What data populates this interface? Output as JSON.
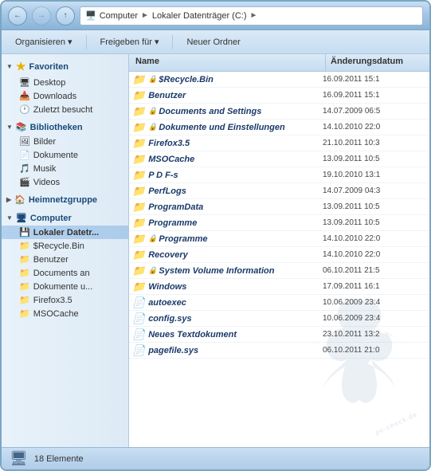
{
  "window": {
    "title": "Lokaler Datenträger (C:)"
  },
  "breadcrumb": {
    "parts": [
      "Computer",
      "Lokaler Datenträger (C:)"
    ]
  },
  "toolbar": {
    "buttons": [
      {
        "label": "Organisieren",
        "has_arrow": true
      },
      {
        "label": "Freigeben für",
        "has_arrow": true
      },
      {
        "label": "Neuer Ordner",
        "has_arrow": false
      }
    ]
  },
  "sidebar": {
    "sections": [
      {
        "header": "Favoriten",
        "expanded": true,
        "items": [
          {
            "label": "Desktop",
            "icon": "desktop"
          },
          {
            "label": "Downloads",
            "icon": "download"
          },
          {
            "label": "Zuletzt besucht",
            "icon": "recent"
          }
        ]
      },
      {
        "header": "Bibliotheken",
        "expanded": true,
        "items": [
          {
            "label": "Bilder",
            "icon": "lib"
          },
          {
            "label": "Dokumente",
            "icon": "lib"
          },
          {
            "label": "Musik",
            "icon": "lib"
          },
          {
            "label": "Videos",
            "icon": "lib"
          }
        ]
      },
      {
        "header": "Heimnetzgruppe",
        "expanded": false,
        "items": []
      },
      {
        "header": "Computer",
        "expanded": true,
        "items": [
          {
            "label": "Lokaler Datetr...",
            "icon": "hdd",
            "active": true
          },
          {
            "label": "$Recycle.Bin",
            "icon": "folder"
          },
          {
            "label": "Benutzer",
            "icon": "folder"
          },
          {
            "label": "Documents an",
            "icon": "folder"
          },
          {
            "label": "Dokumente u...",
            "icon": "folder"
          },
          {
            "label": "Firefox3.5",
            "icon": "folder"
          },
          {
            "label": "MSOCache",
            "icon": "folder"
          }
        ]
      }
    ]
  },
  "file_list": {
    "columns": [
      "Name",
      "Änderungsdatum"
    ],
    "files": [
      {
        "name": "$Recycle.Bin",
        "date": "16.09.2011 15:1",
        "icon": "folder",
        "locked": true
      },
      {
        "name": "Benutzer",
        "date": "16.09.2011 15:1",
        "icon": "folder",
        "locked": false
      },
      {
        "name": "Documents and Settings",
        "date": "14.07.2009 06:5",
        "icon": "folder",
        "locked": true
      },
      {
        "name": "Dokumente und Einstellungen",
        "date": "14.10.2010 22:0",
        "icon": "folder",
        "locked": true
      },
      {
        "name": "Firefox3.5",
        "date": "21.10.2011 10:3",
        "icon": "folder",
        "locked": false
      },
      {
        "name": "MSOCache",
        "date": "13.09.2011 10:5",
        "icon": "folder",
        "locked": false
      },
      {
        "name": "P D F-s",
        "date": "19.10.2010 13:1",
        "icon": "folder",
        "locked": false
      },
      {
        "name": "PerfLogs",
        "date": "14.07.2009 04:3",
        "icon": "folder",
        "locked": false
      },
      {
        "name": "ProgramData",
        "date": "13.09.2011 10:5",
        "icon": "folder",
        "locked": false
      },
      {
        "name": "Programme",
        "date": "13.09.2011 10:5",
        "icon": "folder",
        "locked": false
      },
      {
        "name": "Programme",
        "date": "14.10.2010 22:0",
        "icon": "folder",
        "locked": true
      },
      {
        "name": "Recovery",
        "date": "14.10.2010 22:0",
        "icon": "folder",
        "locked": false
      },
      {
        "name": "System Volume Information",
        "date": "06.10.2011 21:5",
        "icon": "folder",
        "locked": true
      },
      {
        "name": "Windows",
        "date": "17.09.2011 16:1",
        "icon": "folder",
        "locked": false
      },
      {
        "name": "autoexec",
        "date": "10.06.2009 23:4",
        "icon": "file",
        "locked": false
      },
      {
        "name": "config.sys",
        "date": "10.06.2009 23:4",
        "icon": "file",
        "locked": false
      },
      {
        "name": "Neues Textdokument",
        "date": "23.10.2011 13:2",
        "icon": "file",
        "locked": false
      },
      {
        "name": "pagefile.sys",
        "date": "06.10.2011 21:0",
        "icon": "file",
        "locked": false
      }
    ]
  },
  "status_bar": {
    "count_label": "18 Elemente"
  }
}
